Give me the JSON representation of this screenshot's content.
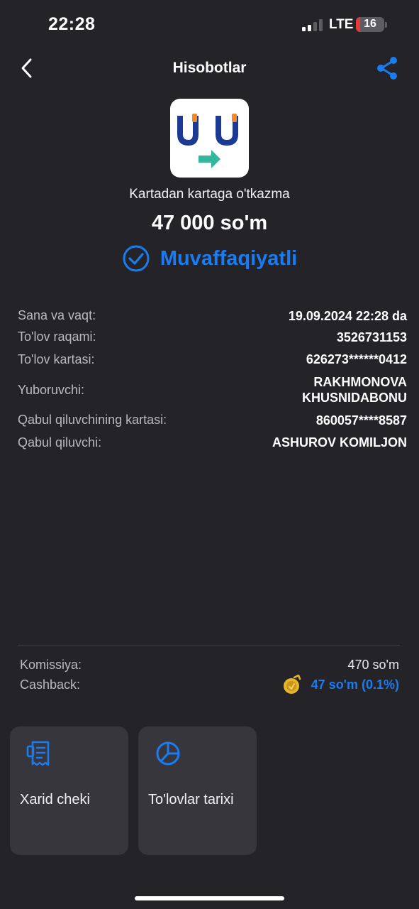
{
  "status_bar": {
    "time": "22:28",
    "network": "LTE",
    "battery_level": "16",
    "signal_bars_active": 2,
    "signal_bars_total": 4
  },
  "header": {
    "title": "Hisobotlar",
    "back_icon": "chevron-left-icon",
    "share_icon": "share-icon"
  },
  "transaction": {
    "service_name": "Kartadan kartaga o'tkazma",
    "amount": "47 000 so'm",
    "status": "Muvaffaqiyatli",
    "status_icon": "check-circle-icon"
  },
  "details": [
    {
      "label": "Sana va vaqt:",
      "value": "19.09.2024 22:28 da"
    },
    {
      "label": "To'lov raqami:",
      "value": "3526731153"
    },
    {
      "label": "To'lov kartasi:",
      "value": "626273******0412"
    },
    {
      "label": "Yuboruvchi:",
      "value": "RAKHMONOVA\nKHUSNIDABONU"
    },
    {
      "label": "Qabul qiluvchining kartasi:",
      "value": "860057****8587"
    },
    {
      "label": "Qabul qiluvchi:",
      "value": "ASHUROV KOMILJON"
    }
  ],
  "fees": {
    "commission_label": "Komissiya:",
    "commission_value": "470 so'm",
    "cashback_label": "Cashback:",
    "cashback_value": "47 so'm (0.1%)",
    "cashback_icon": "coin-icon"
  },
  "actions": [
    {
      "label": "Xarid cheki",
      "icon": "receipt-icon"
    },
    {
      "label": "To'lovlar tarixi",
      "icon": "pie-chart-icon"
    }
  ],
  "colors": {
    "background": "#232328",
    "accent": "#1a7cf0",
    "card": "#36363c",
    "logo_blue": "#1b3a93",
    "logo_orange": "#f08a2a",
    "logo_teal": "#33b79c",
    "coin": "#e7b52c"
  }
}
